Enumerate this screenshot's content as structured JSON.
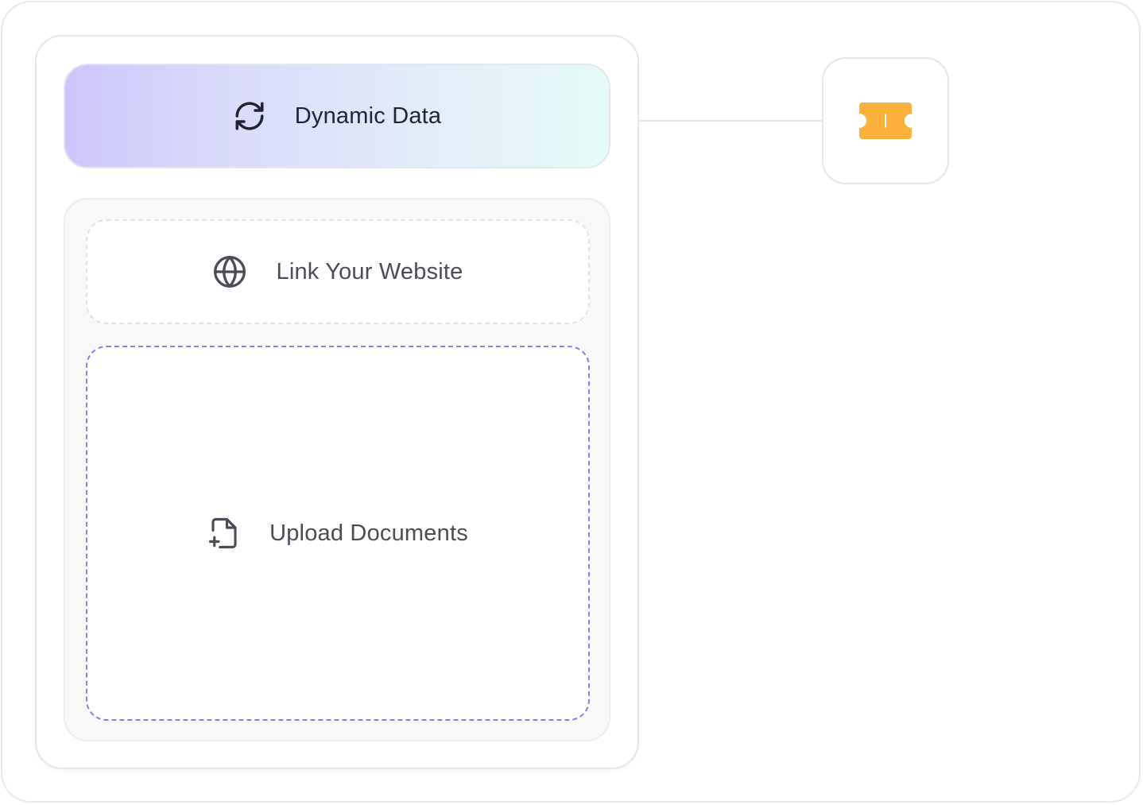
{
  "sources_panel": {
    "dynamic_data": {
      "label": "Dynamic Data",
      "icon": "refresh-icon"
    },
    "link_website": {
      "label": "Link Your Website",
      "icon": "globe-icon"
    },
    "upload_documents": {
      "label": "Upload Documents",
      "icon": "file-plus-icon"
    }
  },
  "connected_node": {
    "icon": "ticket-icon",
    "color": "#fbb13c"
  },
  "colors": {
    "upload_border": "#8b7ff0",
    "gradient_start": "#cdc6fb",
    "gradient_end": "#e6fbf7"
  }
}
